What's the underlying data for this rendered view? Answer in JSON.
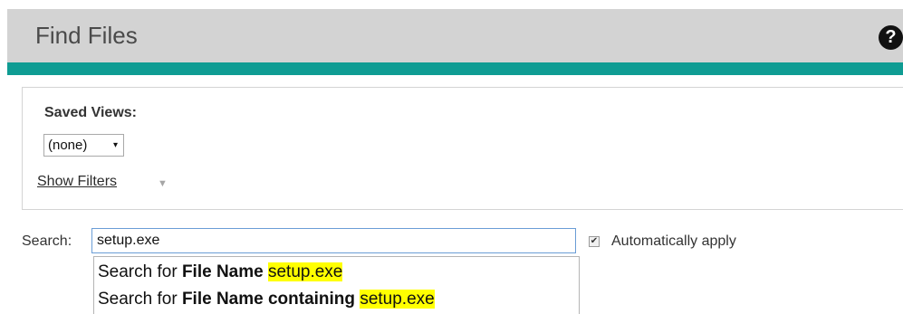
{
  "header": {
    "title": "Find Files",
    "help_icon": "?"
  },
  "filters": {
    "saved_views_label": "Saved Views:",
    "saved_views_selected": "(none)",
    "saved_views_arrow": "▾",
    "show_filters_label": "Show Filters",
    "show_filters_caret": "▼"
  },
  "search": {
    "label": "Search:",
    "value": "setup.exe",
    "auto_apply_checked": true,
    "auto_apply_check_glyph": "✔",
    "auto_apply_label": "Automatically apply"
  },
  "suggestions": [
    {
      "prefix": "Search for ",
      "field": "File Name",
      "between": " ",
      "term": "setup.exe"
    },
    {
      "prefix": "Search for ",
      "field": "File Name containing",
      "between": " ",
      "term": "setup.exe"
    }
  ],
  "colors": {
    "header_bg": "#d3d3d3",
    "accent_teal": "#0f9c93",
    "highlight": "#ffff00"
  }
}
